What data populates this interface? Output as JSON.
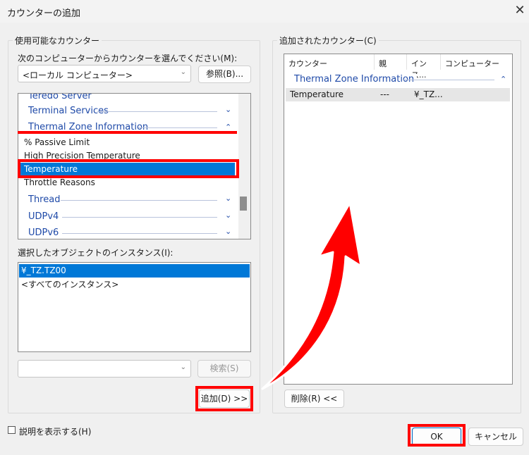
{
  "window": {
    "title": "カウンターの追加",
    "close_glyph": "✕"
  },
  "left": {
    "group_label": "使用可能なカウンター",
    "computer_prompt": "次のコンピューターからカウンターを選んでください(M):",
    "computer_value": "<ローカル コンピューター>",
    "browse_label": "参照(B)...",
    "counter_tree": {
      "partial_top": "Teredo Server",
      "categories": [
        {
          "name": "Terminal Services",
          "expanded": false
        },
        {
          "name": "Thermal Zone Information",
          "expanded": true
        },
        {
          "name": "Thread",
          "expanded": false
        },
        {
          "name": "UDPv4",
          "expanded": false
        },
        {
          "name": "UDPv6",
          "expanded": false
        }
      ],
      "counters": [
        "% Passive Limit",
        "High Precision Temperature",
        "Temperature",
        "Throttle Reasons"
      ],
      "selected_counter": "Temperature"
    },
    "instances_label": "選択したオブジェクトのインスタンス(I):",
    "instances": [
      "¥_TZ.TZ00",
      "<すべてのインスタンス>"
    ],
    "selected_instance": "¥_TZ.TZ00",
    "search_value": "",
    "search_label": "検索(S)",
    "add_label": "追加(D) >>"
  },
  "right": {
    "group_label": "追加されたカウンター(C)",
    "columns": [
      "カウンター",
      "親",
      "インス...",
      "コンピューター"
    ],
    "category": "Thermal Zone Information",
    "row": {
      "counter": "Temperature",
      "parent": "---",
      "instance": "¥_TZ...",
      "computer": ""
    },
    "remove_label": "削除(R) <<"
  },
  "footer": {
    "show_description_label": "説明を表示する(H)",
    "show_description_checked": false,
    "ok_label": "OK",
    "cancel_label": "キャンセル"
  },
  "glyphs": {
    "chevron_down": "⌄",
    "chevron_up": "⌃",
    "combo_arrow": "⌄"
  },
  "colors": {
    "selection": "#0078d7",
    "category_text": "#1f4aa8",
    "annotation": "#ff0000"
  }
}
